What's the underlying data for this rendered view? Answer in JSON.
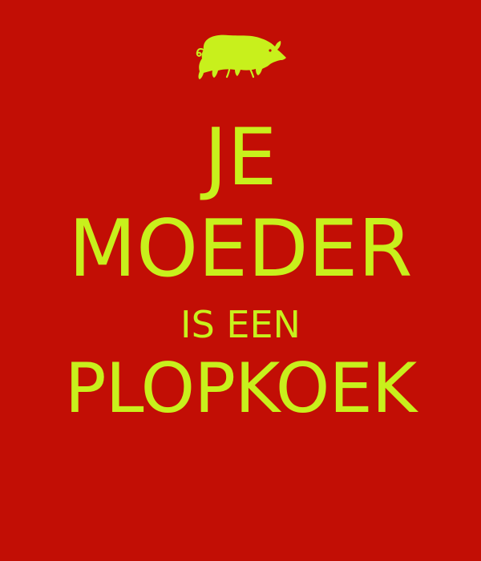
{
  "poster": {
    "line1": "JE",
    "line2": "MOEDER",
    "line3": "IS EEN",
    "line4": "PLOPKOEK"
  },
  "icon": "pig-icon",
  "colors": {
    "background": "#c20e05",
    "text": "#c8f01c",
    "icon": "#c8f01c"
  }
}
